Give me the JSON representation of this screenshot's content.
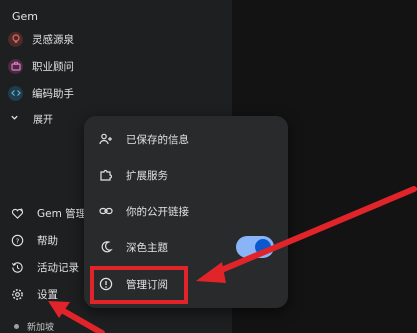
{
  "sidebar": {
    "gem_section_title": "Gem",
    "gems": [
      {
        "label": "灵感源泉",
        "icon": "lightbulb-icon",
        "color": "#e8685a",
        "bg": "#4a2b2a"
      },
      {
        "label": "职业顾问",
        "icon": "briefcase-icon",
        "color": "#e07ac0",
        "bg": "#4a2a43"
      },
      {
        "label": "编码助手",
        "icon": "code-icon",
        "color": "#5ab6d8",
        "bg": "#1f3d4a"
      }
    ],
    "expand_label": "展开",
    "gem_manager_label": "Gem 管理器",
    "help_label": "帮助",
    "activity_label": "活动记录",
    "settings_label": "设置",
    "location_label": "新加坡"
  },
  "settings_menu": {
    "items": [
      {
        "label": "已保存的信息",
        "icon": "person-add-icon"
      },
      {
        "label": "扩展服务",
        "icon": "puzzle-icon"
      },
      {
        "label": "你的公开链接",
        "icon": "link-icon"
      },
      {
        "label": "深色主题",
        "icon": "moon-icon"
      },
      {
        "label": "管理订阅",
        "icon": "subscription-icon"
      }
    ],
    "dark_theme_on": true
  },
  "colors": {
    "annotation_red": "#e0242a",
    "toggle_track": "#8ab4f8",
    "toggle_knob": "#0b57d0"
  }
}
